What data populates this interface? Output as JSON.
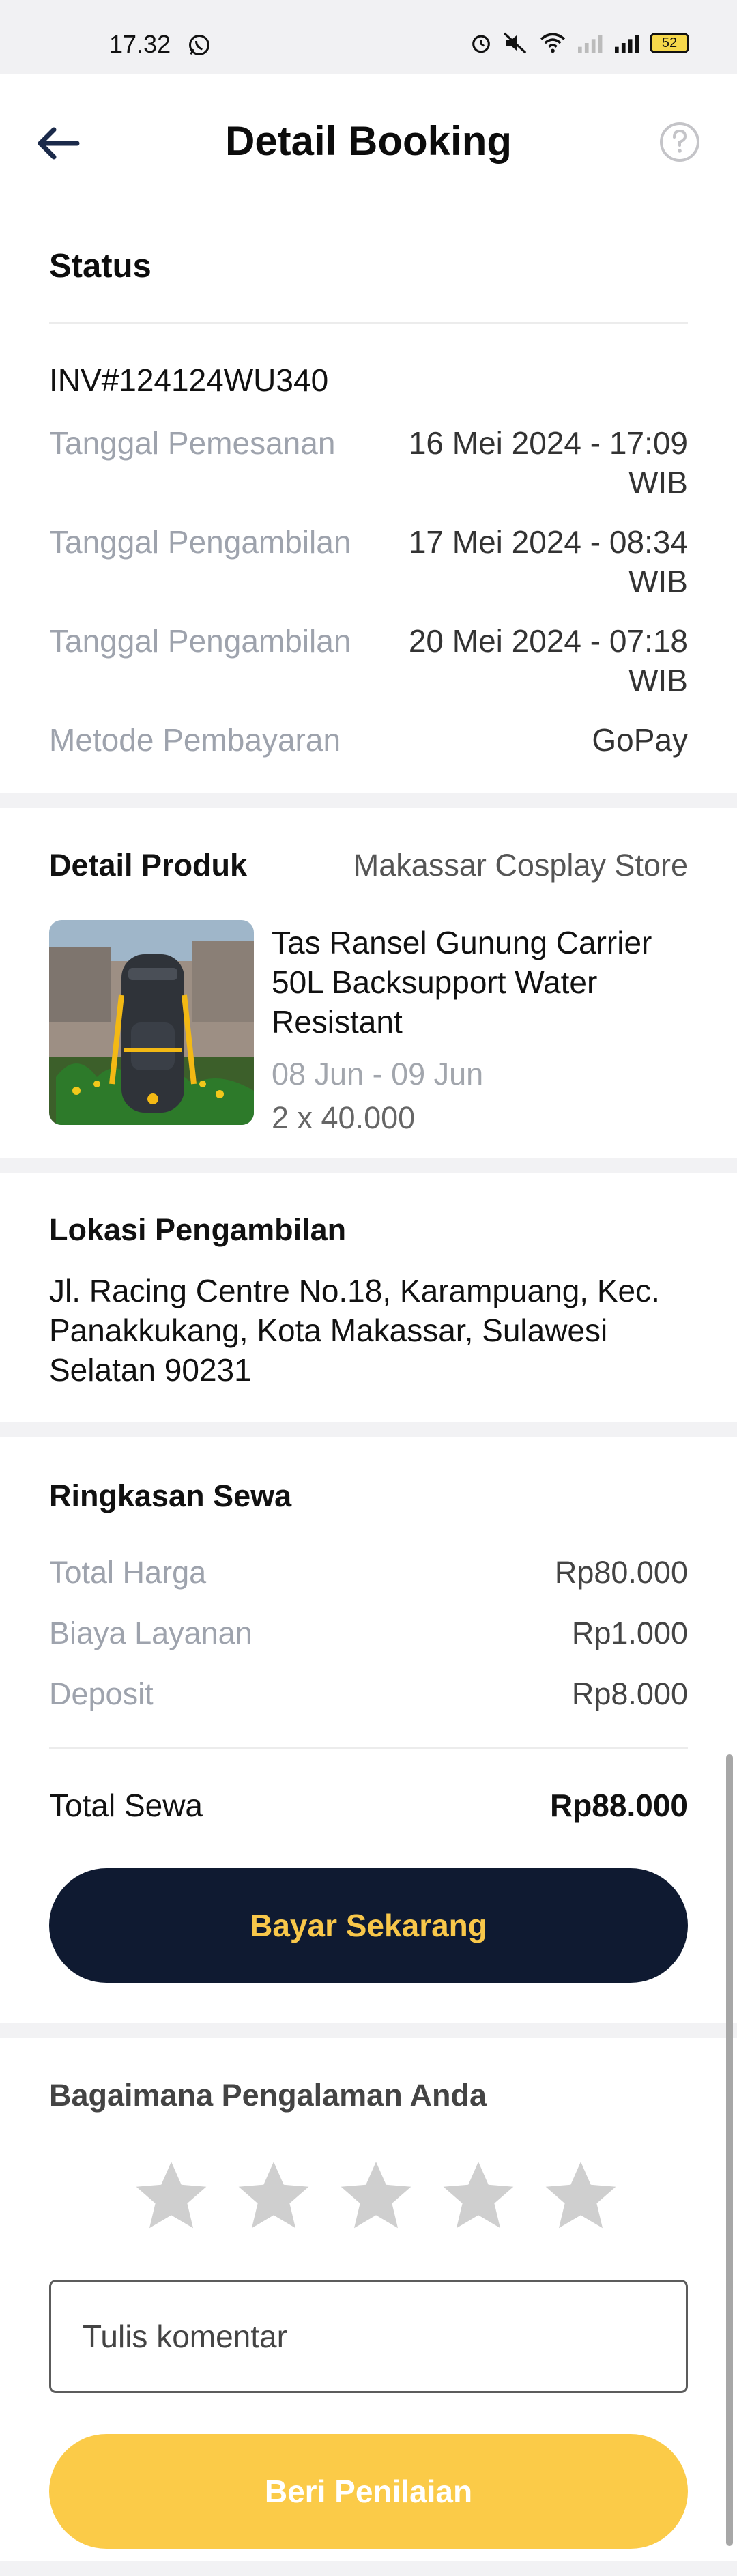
{
  "status_bar": {
    "time": "17.32",
    "battery": "52"
  },
  "header": {
    "title": "Detail Booking"
  },
  "status": {
    "title": "Status",
    "invoice": "INV#124124WU340",
    "rows": [
      {
        "label": "Tanggal Pemesanan",
        "value": "16 Mei 2024 - 17:09 WIB"
      },
      {
        "label": "Tanggal Pengambilan",
        "value": "17 Mei 2024 - 08:34 WIB"
      },
      {
        "label": "Tanggal Pengambilan",
        "value": "20 Mei 2024 - 07:18 WIB"
      },
      {
        "label": "Metode Pembayaran",
        "value": "GoPay"
      }
    ]
  },
  "product": {
    "title": "Detail Produk",
    "store": "Makassar Cosplay Store",
    "name": "Tas Ransel Gunung Carrier 50L Backsupport Water Resistant",
    "dates": "08 Jun - 09 Jun",
    "qty": "2 x 40.000"
  },
  "location": {
    "title": "Lokasi Pengambilan",
    "address": "Jl. Racing Centre No.18, Karampuang, Kec. Panakkukang, Kota Makassar, Sulawesi Selatan 90231"
  },
  "summary": {
    "title": "Ringkasan Sewa",
    "rows": [
      {
        "label": "Total Harga",
        "value": "Rp80.000"
      },
      {
        "label": "Biaya Layanan",
        "value": "Rp1.000"
      },
      {
        "label": "Deposit",
        "value": "Rp8.000"
      }
    ],
    "total_label": "Total Sewa",
    "total_value": "Rp88.000",
    "pay_button": "Bayar Sekarang"
  },
  "rating": {
    "title": "Bagaimana Pengalaman Anda",
    "stars_filled": 0,
    "stars_total": 5,
    "comment_placeholder": "Tulis komentar",
    "submit_button": "Beri Penilaian"
  },
  "colors": {
    "primary_dark": "#0f1a31",
    "accent_yellow": "#f8c74a",
    "star_inactive": "#cfcfcf"
  },
  "icons": [
    "back-arrow-icon",
    "help-circle-icon",
    "whatsapp-icon",
    "alarm-icon",
    "mute-icon",
    "wifi-icon",
    "signal-icon",
    "battery-icon",
    "star-icon"
  ]
}
